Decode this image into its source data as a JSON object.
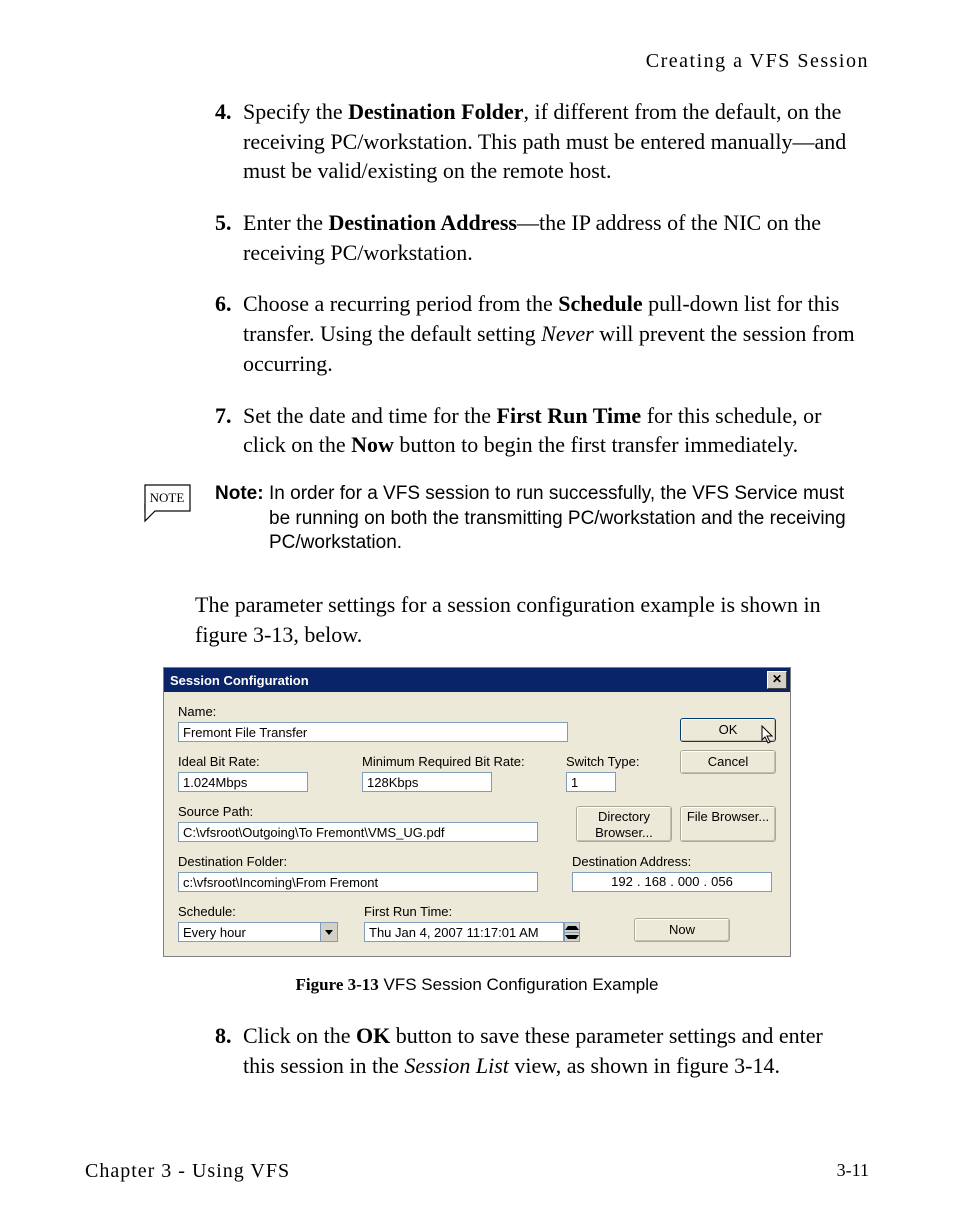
{
  "running_head": "Creating a VFS Session",
  "steps": {
    "s4": {
      "num": "4.",
      "text_before": " Specify the ",
      "bold1": "Destination Folder",
      "text_after": ", if different from the default, on the receiving PC/workstation. This path must be entered manually—and must be valid/existing on the remote host."
    },
    "s5": {
      "num": "5.",
      "text_before": " Enter the ",
      "bold1": "Destination Address",
      "text_after": "—the IP address of the NIC on the receiving PC/workstation."
    },
    "s6": {
      "num": "6.",
      "text_before": " Choose a recurring period from the ",
      "bold1": "Schedule",
      "mid": " pull-down list for this transfer. Using the default setting ",
      "ital1": "Never",
      "text_after": " will prevent the session from occurring."
    },
    "s7": {
      "num": "7.",
      "text_before": " Set the date and time for the ",
      "bold1": "First Run Time",
      "mid": " for this schedule, or click on the ",
      "bold2": "Now",
      "text_after": " button to begin the first transfer immediately."
    },
    "s8": {
      "num": "8.",
      "text_before": " Click on the ",
      "bold1": "OK",
      "mid": " button to save these parameter settings and enter this session in the ",
      "ital1": "Session List",
      "text_after": " view, as shown in figure 3-14."
    }
  },
  "note": {
    "badge": "NOTE",
    "label": "Note:",
    "text": "In order for a VFS session to run successfully, the VFS Service must be running on both the transmitting PC/workstation and the receiving PC/workstation."
  },
  "para": "The parameter settings for a session configuration example is shown in figure 3-13, below.",
  "dialog": {
    "title": "Session Configuration",
    "labels": {
      "name": "Name:",
      "ideal": "Ideal Bit Rate:",
      "minreq": "Minimum Required Bit Rate:",
      "switch": "Switch Type:",
      "source": "Source Path:",
      "destfolder": "Destination Folder:",
      "destaddr": "Destination Address:",
      "schedule": "Schedule:",
      "firstrun": "First Run Time:"
    },
    "values": {
      "name": "Fremont File Transfer",
      "ideal": "1.024Mbps",
      "minreq": "128Kbps",
      "switch": "1",
      "source": "C:\\vfsroot\\Outgoing\\To Fremont\\VMS_UG.pdf",
      "destfolder": "c:\\vfsroot\\Incoming\\From Fremont",
      "ip": {
        "a": "192",
        "b": "168",
        "c": "000",
        "d": "056"
      },
      "schedule": "Every hour",
      "firstrun": "Thu Jan  4, 2007 11:17:01 AM"
    },
    "buttons": {
      "ok": "OK",
      "cancel": "Cancel",
      "dirbrowse": "Directory Browser...",
      "filebrowse": "File Browser...",
      "now": "Now"
    }
  },
  "fig_caption": {
    "label": "Figure 3-13",
    "text": "  VFS Session Configuration Example"
  },
  "footer": {
    "left": "Chapter 3 - Using VFS",
    "right": "3-11"
  }
}
